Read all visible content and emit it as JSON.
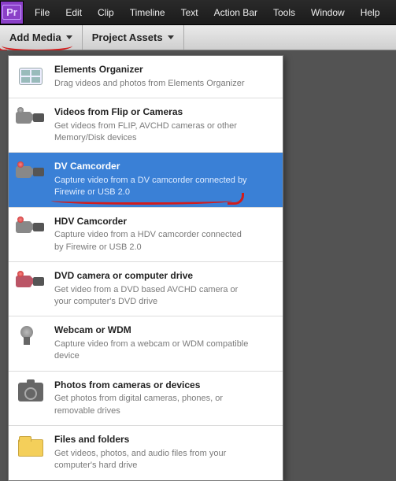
{
  "menu": [
    "File",
    "Edit",
    "Clip",
    "Timeline",
    "Text",
    "Action Bar",
    "Tools",
    "Window",
    "Help"
  ],
  "toolbar": {
    "add_media": "Add Media",
    "project_assets": "Project Assets"
  },
  "dropdown": {
    "items": [
      {
        "title": "Elements Organizer",
        "desc": "Drag videos and photos from Elements Organizer"
      },
      {
        "title": "Videos from Flip or Cameras",
        "desc": "Get videos from FLIP, AVCHD cameras or other Memory/Disk devices"
      },
      {
        "title": "DV Camcorder",
        "desc": "Capture video from a DV camcorder connected by Firewire or USB 2.0"
      },
      {
        "title": "HDV Camcorder",
        "desc": "Capture video from a HDV camcorder connected by Firewire or USB 2.0"
      },
      {
        "title": "DVD camera or computer drive",
        "desc": "Get video from a DVD based AVCHD camera or your computer's DVD drive"
      },
      {
        "title": "Webcam or WDM",
        "desc": "Capture video from a webcam or WDM compatible device"
      },
      {
        "title": "Photos from cameras or devices",
        "desc": "Get photos from digital cameras, phones, or removable drives"
      },
      {
        "title": "Files and folders",
        "desc": "Get videos, photos, and audio files from your computer's hard drive"
      }
    ],
    "selected_index": 2
  }
}
